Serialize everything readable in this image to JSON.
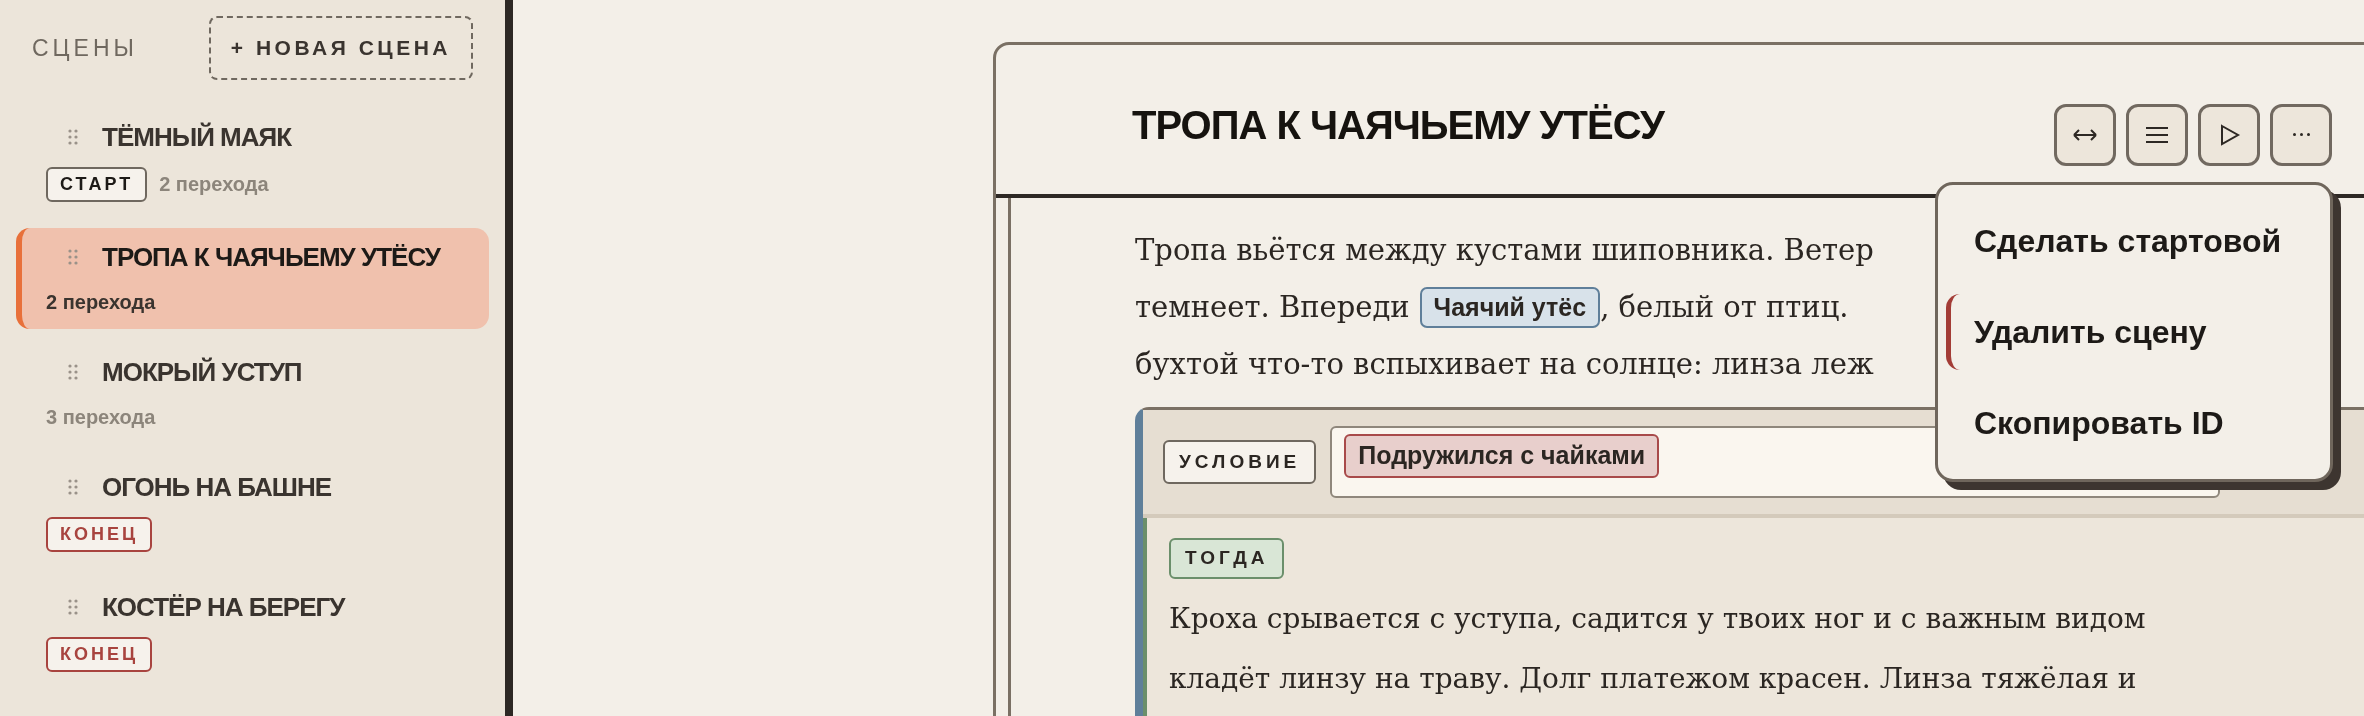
{
  "sidebar": {
    "title": "СЦЕНЫ",
    "new_button": "+ НОВАЯ СЦЕНА",
    "scenes": [
      {
        "title": "ТЁМНЫЙ МАЯК",
        "badge": {
          "kind": "start",
          "label": "СТАРТ"
        },
        "transitions": "2 перехода",
        "selected": false
      },
      {
        "title": "ТРОПА К ЧАЯЧЬЕМУ УТЁСУ",
        "transitions": "2 перехода",
        "selected": true
      },
      {
        "title": "МОКРЫЙ УСТУП",
        "transitions": "3 перехода",
        "selected": false
      },
      {
        "title": "ОГОНЬ НА БАШНЕ",
        "badge": {
          "kind": "end",
          "label": "КОНЕЦ"
        },
        "selected": false
      },
      {
        "title": "КОСТЁР НА БЕРЕГУ",
        "badge": {
          "kind": "end",
          "label": "КОНЕЦ"
        },
        "selected": false
      }
    ]
  },
  "editor": {
    "title": "ТРОПА К ЧАЯЧЬЕМУ УТЁСУ",
    "paragraph_lines": [
      [
        {
          "kind": "text",
          "text": "Тропа вьётся между кустами шиповника. Ветер"
        }
      ],
      [
        {
          "kind": "text",
          "text": "темнеет. Впереди"
        },
        {
          "kind": "link",
          "text": "Чаячий утёс"
        },
        {
          "kind": "text",
          "text": ", белый от птиц."
        }
      ],
      [
        {
          "kind": "text",
          "text": "бухтой что-то вспыхивает на солнце: линза леж"
        }
      ]
    ],
    "condition_block": {
      "condition_label": "УСЛОВИЕ",
      "condition_chip": "Подружился с чайками",
      "then_label": "ТОГДА",
      "then_lines": [
        "Кроха срывается с уступа, садится у твоих ног и с важным видом",
        "кладёт линзу на траву. Долг платежом красен. Линза тяжёлая и"
      ]
    },
    "menu": {
      "items": [
        {
          "label": "Сделать стартовой",
          "highlighted": false
        },
        {
          "label": "Удалить сцену",
          "highlighted": true
        },
        {
          "label": "Скопировать ID",
          "highlighted": false
        }
      ]
    }
  }
}
